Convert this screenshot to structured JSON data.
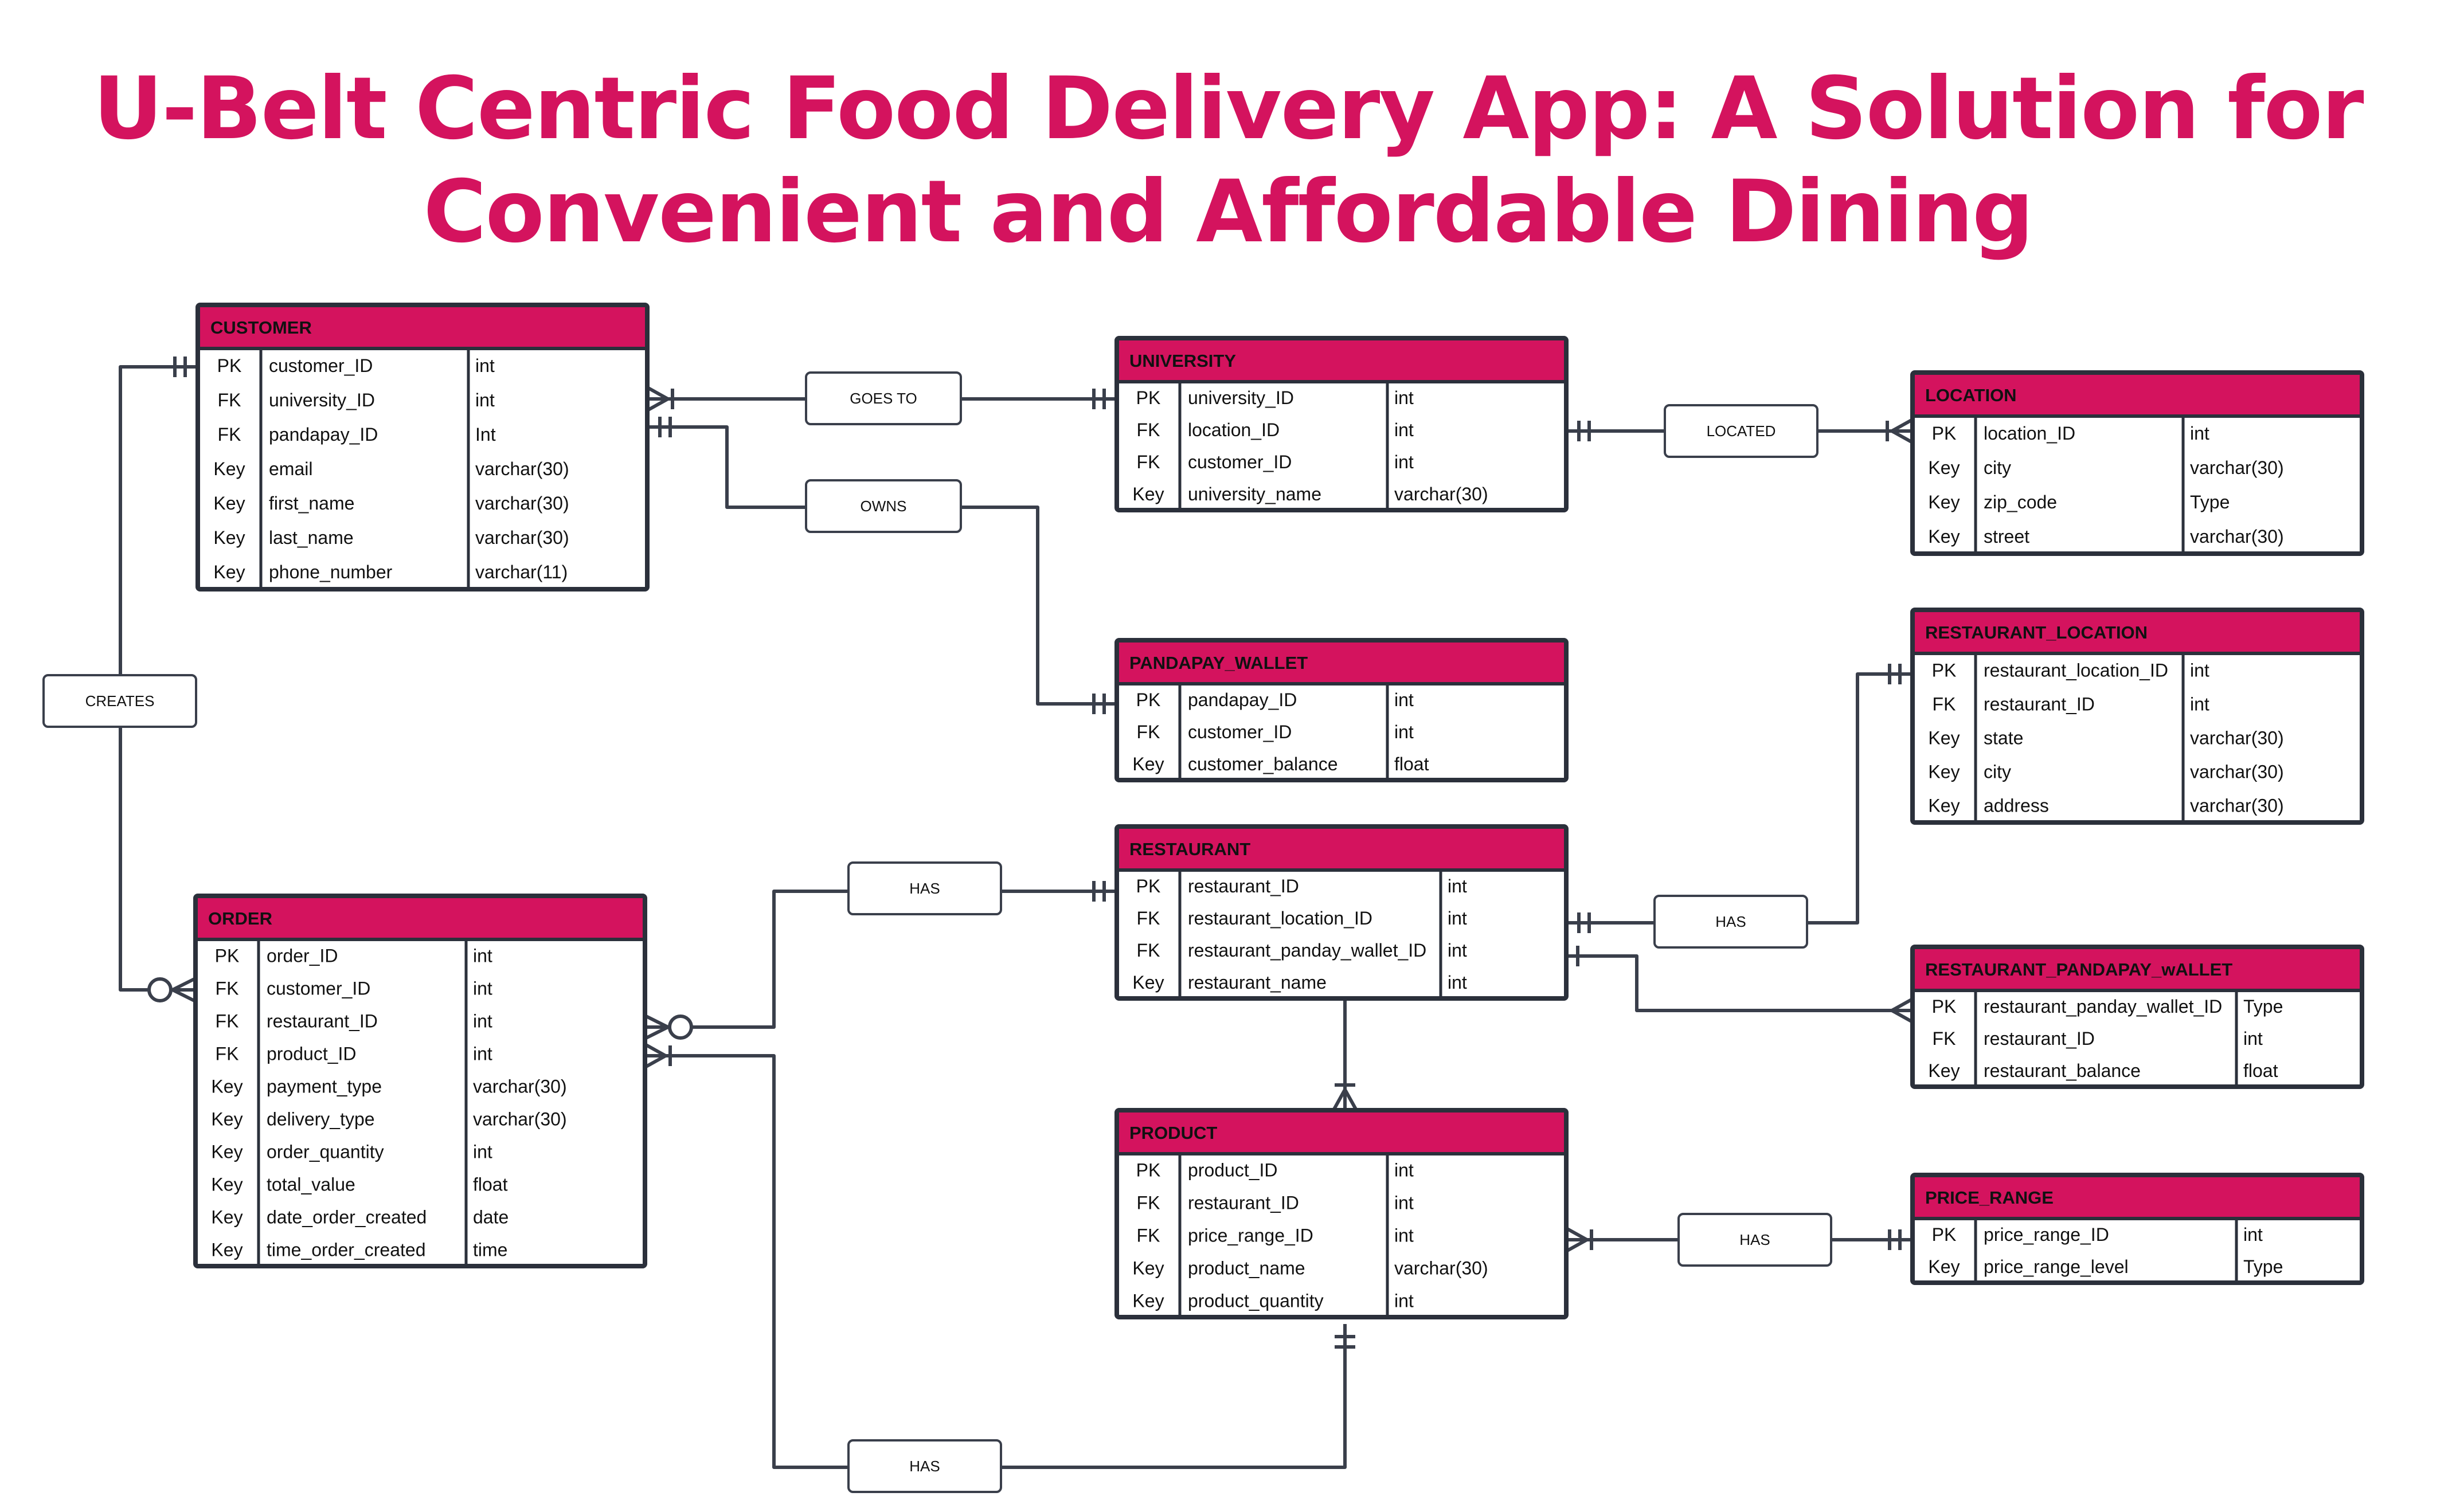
{
  "title": {
    "line1": "U-Belt Centric Food Delivery App: A Solution for",
    "line2": "Convenient and Affordable Dining"
  },
  "colors": {
    "accent": "#d4135e",
    "border": "#2b303b",
    "line": "#3a3f4b"
  },
  "entities": {
    "customer": {
      "name": "CUSTOMER",
      "rows": [
        {
          "k": "PK",
          "f": "customer_ID",
          "t": "int"
        },
        {
          "k": "FK",
          "f": "university_ID",
          "t": "int"
        },
        {
          "k": "FK",
          "f": "pandapay_ID",
          "t": "Int"
        },
        {
          "k": "Key",
          "f": "email",
          "t": "varchar(30)"
        },
        {
          "k": "Key",
          "f": "first_name",
          "t": "varchar(30)"
        },
        {
          "k": "Key",
          "f": "last_name",
          "t": "varchar(30)"
        },
        {
          "k": "Key",
          "f": "phone_number",
          "t": "varchar(11)"
        }
      ]
    },
    "university": {
      "name": "UNIVERSITY",
      "rows": [
        {
          "k": "PK",
          "f": "university_ID",
          "t": "int"
        },
        {
          "k": "FK",
          "f": "location_ID",
          "t": "int"
        },
        {
          "k": "FK",
          "f": "customer_ID",
          "t": "int"
        },
        {
          "k": "Key",
          "f": "university_name",
          "t": "varchar(30)"
        }
      ]
    },
    "location": {
      "name": "LOCATION",
      "rows": [
        {
          "k": "PK",
          "f": "location_ID",
          "t": "int"
        },
        {
          "k": "Key",
          "f": "city",
          "t": "varchar(30)"
        },
        {
          "k": "Key",
          "f": "zip_code",
          "t": "Type"
        },
        {
          "k": "Key",
          "f": "street",
          "t": "varchar(30)"
        }
      ]
    },
    "pandapay_wallet": {
      "name": "PANDAPAY_WALLET",
      "rows": [
        {
          "k": "PK",
          "f": "pandapay_ID",
          "t": "int"
        },
        {
          "k": "FK",
          "f": "customer_ID",
          "t": "int"
        },
        {
          "k": "Key",
          "f": "customer_balance",
          "t": "float"
        }
      ]
    },
    "restaurant_location": {
      "name": "RESTAURANT_LOCATION",
      "rows": [
        {
          "k": "PK",
          "f": "restaurant_location_ID",
          "t": "int"
        },
        {
          "k": "FK",
          "f": "restaurant_ID",
          "t": "int"
        },
        {
          "k": "Key",
          "f": "state",
          "t": "varchar(30)"
        },
        {
          "k": "Key",
          "f": "city",
          "t": "varchar(30)"
        },
        {
          "k": "Key",
          "f": "address",
          "t": "varchar(30)"
        }
      ]
    },
    "restaurant": {
      "name": "RESTAURANT",
      "rows": [
        {
          "k": "PK",
          "f": "restaurant_ID",
          "t": "int"
        },
        {
          "k": "FK",
          "f": "restaurant_location_ID",
          "t": "int"
        },
        {
          "k": "FK",
          "f": "restaurant_panday_wallet_ID",
          "t": "int"
        },
        {
          "k": "Key",
          "f": "restaurant_name",
          "t": "int"
        }
      ]
    },
    "restaurant_pandapay_wallet": {
      "name": "RESTAURANT_PANDAPAY_wALLET",
      "rows": [
        {
          "k": "PK",
          "f": "restaurant_panday_wallet_ID",
          "t": "Type"
        },
        {
          "k": "FK",
          "f": "restaurant_ID",
          "t": "int"
        },
        {
          "k": "Key",
          "f": "restaurant_balance",
          "t": "float"
        }
      ]
    },
    "order": {
      "name": "ORDER",
      "rows": [
        {
          "k": "PK",
          "f": "order_ID",
          "t": "int"
        },
        {
          "k": "FK",
          "f": "customer_ID",
          "t": "int"
        },
        {
          "k": "FK",
          "f": "restaurant_ID",
          "t": "int"
        },
        {
          "k": "FK",
          "f": "product_ID",
          "t": "int"
        },
        {
          "k": "Key",
          "f": "payment_type",
          "t": "varchar(30)"
        },
        {
          "k": "Key",
          "f": "delivery_type",
          "t": "varchar(30)"
        },
        {
          "k": "Key",
          "f": "order_quantity",
          "t": "int"
        },
        {
          "k": "Key",
          "f": "total_value",
          "t": "float"
        },
        {
          "k": "Key",
          "f": "date_order_created",
          "t": "date"
        },
        {
          "k": "Key",
          "f": "time_order_created",
          "t": "time"
        }
      ]
    },
    "product": {
      "name": "PRODUCT",
      "rows": [
        {
          "k": "PK",
          "f": "product_ID",
          "t": "int"
        },
        {
          "k": "FK",
          "f": "restaurant_ID",
          "t": "int"
        },
        {
          "k": "FK",
          "f": "price_range_ID",
          "t": "int"
        },
        {
          "k": "Key",
          "f": "product_name",
          "t": "varchar(30)"
        },
        {
          "k": "Key",
          "f": "product_quantity",
          "t": "int"
        }
      ]
    },
    "price_range": {
      "name": "PRICE_RANGE",
      "rows": [
        {
          "k": "PK",
          "f": "price_range_ID",
          "t": "int"
        },
        {
          "k": "Key",
          "f": "price_range_level",
          "t": "Type"
        }
      ]
    }
  },
  "relationships": {
    "goes_to": "GOES TO",
    "located": "LOCATED",
    "owns": "OWNS",
    "creates": "CREATES",
    "restaurant_has_location": "HAS",
    "order_has_restaurant": "HAS",
    "product_has_price_range": "HAS",
    "order_has_product": "HAS"
  }
}
